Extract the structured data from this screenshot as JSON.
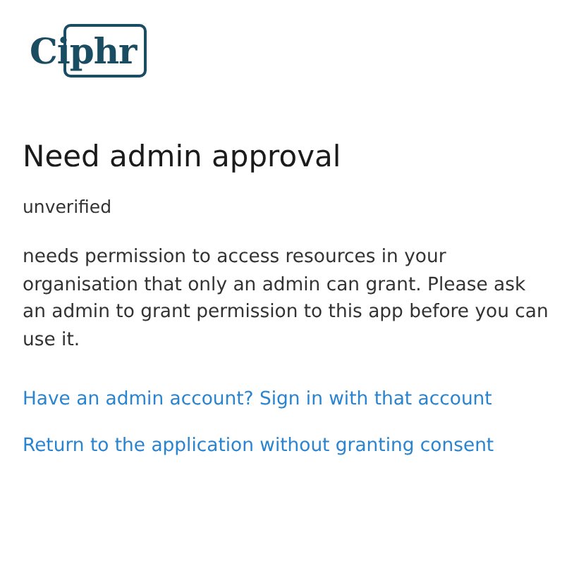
{
  "logo": "Ciphr",
  "title": "Need admin approval",
  "app_status": "unverified",
  "message": "needs permission to access resources in your organisation that only an admin can grant. Please ask an admin to grant permission to this app before you can use it.",
  "links": [
    "Have an admin account? Sign in with that account",
    "Return to the application without granting consent"
  ]
}
